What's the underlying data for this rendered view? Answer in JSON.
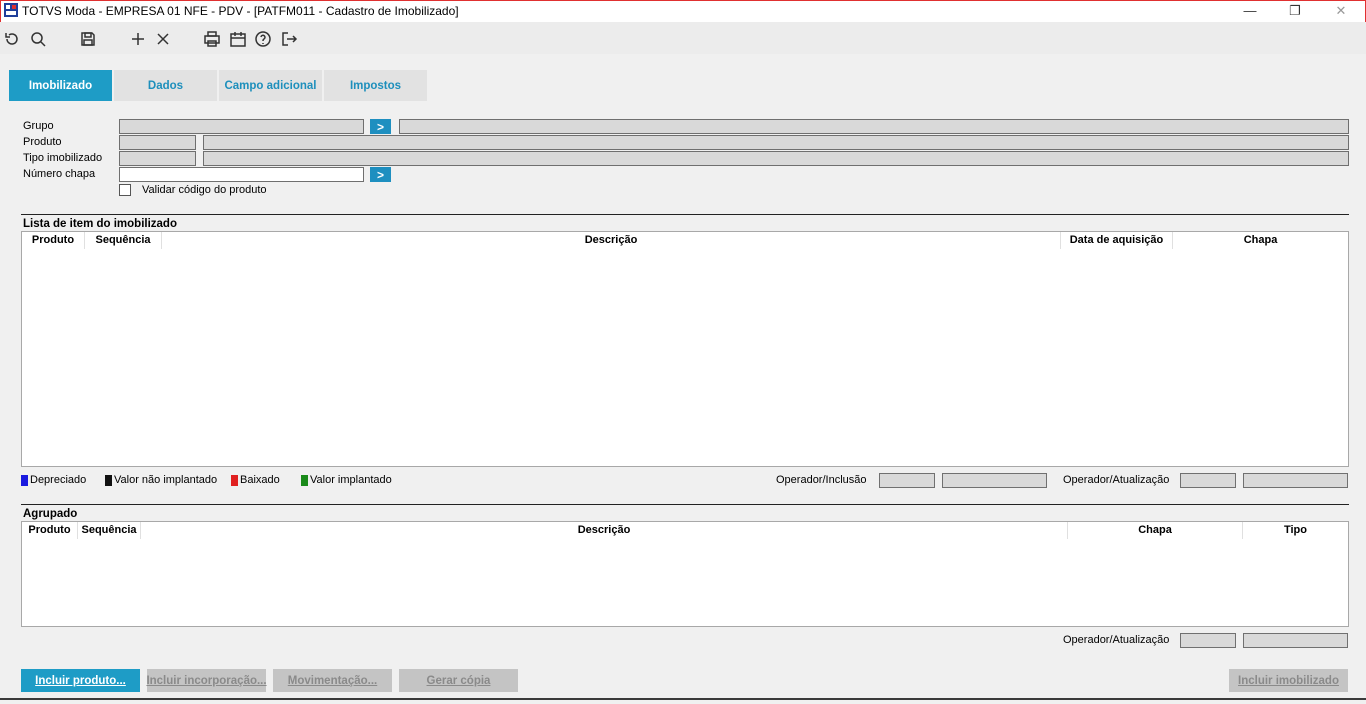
{
  "window": {
    "title": "TOTVS Moda - EMPRESA 01 NFE - PDV - [PATFM011 - Cadastro de Imobilizado]",
    "minimize": "—",
    "restore": "❐",
    "close": "✕"
  },
  "toolbar": {
    "icons": [
      "undo-icon",
      "search-icon",
      "save-icon",
      "add-icon",
      "delete-icon",
      "print-icon",
      "calendar-icon",
      "help-icon",
      "exit-icon"
    ]
  },
  "tabs": [
    {
      "label": "Imobilizado",
      "active": true
    },
    {
      "label": "Dados"
    },
    {
      "label": "Campo adicional"
    },
    {
      "label": "Impostos"
    }
  ],
  "form": {
    "grupo_label": "Grupo",
    "produto_label": "Produto",
    "tipo_label": "Tipo imobilizado",
    "chapa_label": "Número chapa",
    "validar_label": "Validar código do produto",
    "go_symbol": ">"
  },
  "lista": {
    "title": "Lista de item do imobilizado",
    "columns": [
      "Produto",
      "Sequência",
      "Descrição",
      "Data de aquisição",
      "Chapa"
    ]
  },
  "legend": [
    {
      "label": "Depreciado",
      "color": "#1a1adf"
    },
    {
      "label": "Valor não implantado",
      "color": "#111111"
    },
    {
      "label": "Baixado",
      "color": "#e02020"
    },
    {
      "label": "Valor implantado",
      "color": "#1a8a1a"
    }
  ],
  "operador_inclusao_label": "Operador/Inclusão",
  "operador_atualizacao_label": "Operador/Atualização",
  "agrupado": {
    "title": "Agrupado",
    "columns": [
      "Produto",
      "Sequência",
      "Descrição",
      "Chapa",
      "Tipo"
    ],
    "operador_atualizacao_label": "Operador/Atualização"
  },
  "buttons": {
    "incluir_produto": "Incluir produto...",
    "incluir_incorporacao": "Incluir incorporação...",
    "movimentacao": "Movimentação...",
    "gerar_copia": "Gerar cópia",
    "incluir_imobilizado": "Incluir imobilizado"
  }
}
